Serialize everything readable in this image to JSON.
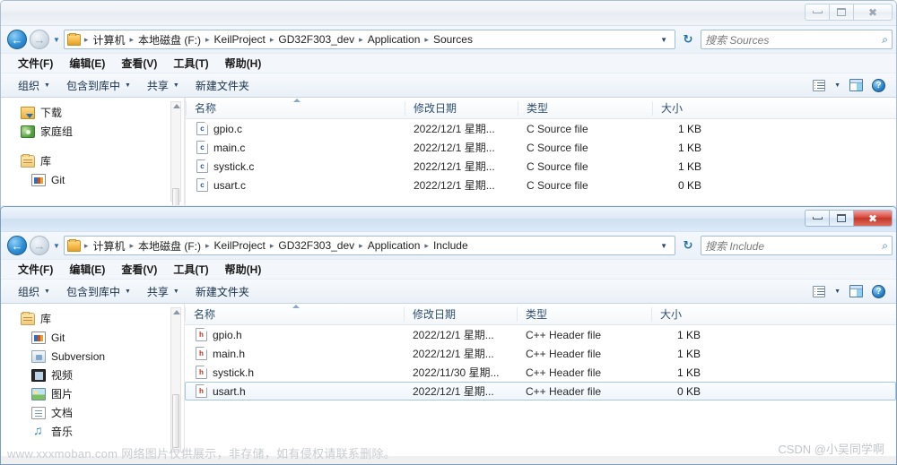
{
  "windows": [
    {
      "id": "sources",
      "state": "inactive",
      "caption": {
        "minimize": "minimize-button",
        "maximize": "maximize-button",
        "close": "✖"
      },
      "address": {
        "back_glyph": "←",
        "forward_glyph": "→",
        "dropdown_glyph": "▼",
        "crumbs": [
          "计算机",
          "本地磁盘 (F:)",
          "KeilProject",
          "GD32F303_dev",
          "Application",
          "Sources"
        ],
        "separator": "▸",
        "caret": "▼",
        "refresh_glyph": "↻"
      },
      "search": {
        "placeholder": "搜索 Sources",
        "icon": "⌕"
      },
      "menu": [
        "文件(F)",
        "编辑(E)",
        "查看(V)",
        "工具(T)",
        "帮助(H)"
      ],
      "toolbar": {
        "items": [
          {
            "label": "组织",
            "caret": "▼"
          },
          {
            "label": "包含到库中",
            "caret": "▼"
          },
          {
            "label": "共享",
            "caret": "▼"
          },
          {
            "label": "新建文件夹",
            "caret": ""
          }
        ],
        "view_caret": "▼",
        "help_glyph": "?"
      },
      "navpane": [
        {
          "label": "下载",
          "icon": "download-icon",
          "indent": false
        },
        {
          "label": "家庭组",
          "icon": "homegroup-icon",
          "indent": false
        },
        {
          "label": "",
          "icon": "spacer",
          "indent": false
        },
        {
          "label": "库",
          "icon": "library-icon",
          "indent": false
        },
        {
          "label": "Git",
          "icon": "git-icon",
          "indent": true
        }
      ],
      "columns": [
        "名称",
        "修改日期",
        "类型",
        "大小"
      ],
      "files": [
        {
          "name": "gpio.c",
          "date": "2022/12/1 星期...",
          "type": "C Source file",
          "size": "1 KB",
          "icon": "c-file-icon",
          "icon_letter": "c",
          "selected": false
        },
        {
          "name": "main.c",
          "date": "2022/12/1 星期...",
          "type": "C Source file",
          "size": "1 KB",
          "icon": "c-file-icon",
          "icon_letter": "c",
          "selected": false
        },
        {
          "name": "systick.c",
          "date": "2022/12/1 星期...",
          "type": "C Source file",
          "size": "1 KB",
          "icon": "c-file-icon",
          "icon_letter": "c",
          "selected": false
        },
        {
          "name": "usart.c",
          "date": "2022/12/1 星期...",
          "type": "C Source file",
          "size": "0 KB",
          "icon": "c-file-icon",
          "icon_letter": "c",
          "selected": false
        }
      ]
    },
    {
      "id": "include",
      "state": "active",
      "caption": {
        "minimize": "minimize-button",
        "maximize": "maximize-button",
        "close": "✖"
      },
      "address": {
        "back_glyph": "←",
        "forward_glyph": "→",
        "dropdown_glyph": "▼",
        "crumbs": [
          "计算机",
          "本地磁盘 (F:)",
          "KeilProject",
          "GD32F303_dev",
          "Application",
          "Include"
        ],
        "separator": "▸",
        "caret": "▼",
        "refresh_glyph": "↻"
      },
      "search": {
        "placeholder": "搜索 Include",
        "icon": "⌕"
      },
      "menu": [
        "文件(F)",
        "编辑(E)",
        "查看(V)",
        "工具(T)",
        "帮助(H)"
      ],
      "toolbar": {
        "items": [
          {
            "label": "组织",
            "caret": "▼"
          },
          {
            "label": "包含到库中",
            "caret": "▼"
          },
          {
            "label": "共享",
            "caret": "▼"
          },
          {
            "label": "新建文件夹",
            "caret": ""
          }
        ],
        "view_caret": "▼",
        "help_glyph": "?"
      },
      "navpane": [
        {
          "label": "库",
          "icon": "library-icon",
          "indent": false
        },
        {
          "label": "Git",
          "icon": "git-icon",
          "indent": true
        },
        {
          "label": "Subversion",
          "icon": "subversion-icon",
          "indent": true
        },
        {
          "label": "视频",
          "icon": "video-icon",
          "indent": true
        },
        {
          "label": "图片",
          "icon": "picture-icon",
          "indent": true
        },
        {
          "label": "文档",
          "icon": "document-icon",
          "indent": true
        },
        {
          "label": "音乐",
          "icon": "music-icon",
          "indent": true
        }
      ],
      "columns": [
        "名称",
        "修改日期",
        "类型",
        "大小"
      ],
      "files": [
        {
          "name": "gpio.h",
          "date": "2022/12/1 星期...",
          "type": "C++ Header file",
          "size": "1 KB",
          "icon": "h-file-icon",
          "icon_letter": "h",
          "selected": false
        },
        {
          "name": "main.h",
          "date": "2022/12/1 星期...",
          "type": "C++ Header file",
          "size": "1 KB",
          "icon": "h-file-icon",
          "icon_letter": "h",
          "selected": false
        },
        {
          "name": "systick.h",
          "date": "2022/11/30 星期...",
          "type": "C++ Header file",
          "size": "1 KB",
          "icon": "h-file-icon",
          "icon_letter": "h",
          "selected": false
        },
        {
          "name": "usart.h",
          "date": "2022/12/1 星期...",
          "type": "C++ Header file",
          "size": "0 KB",
          "icon": "h-file-icon",
          "icon_letter": "h",
          "selected": true
        }
      ]
    }
  ],
  "watermarks": {
    "left": "www.xxxmoban.com 网络图片仅供展示，非存储，如有侵权请联系删除。",
    "right": "CSDN @小吴同学啊"
  },
  "colors": {
    "accent": "#2e8ed4",
    "close_red": "#c0392b",
    "selection_border": "#a7c6e0",
    "c_icon": "#2b4fa0",
    "h_icon": "#b8341f"
  }
}
